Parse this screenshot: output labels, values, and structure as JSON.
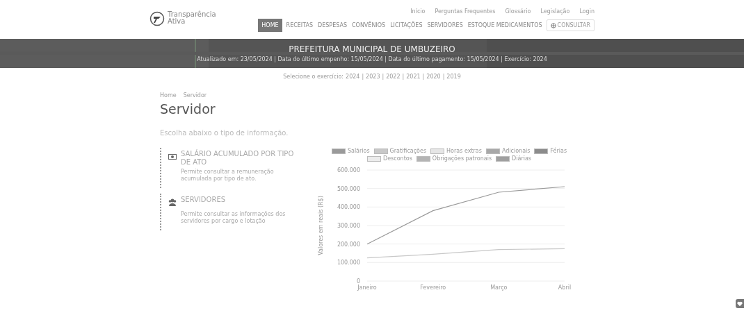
{
  "header": {
    "logo_text": [
      "Transparência",
      "Ativa"
    ],
    "top_links": [
      "Início",
      "Perguntas Frequentes",
      "Glossário",
      "Legislação",
      "Login"
    ],
    "nav": [
      {
        "label": "HOME",
        "selected": true
      },
      {
        "label": "RECEITAS",
        "selected": false
      },
      {
        "label": "DESPESAS",
        "selected": false
      },
      {
        "label": "CONVÊNIOS",
        "selected": false
      },
      {
        "label": "LICITAÇÕES",
        "selected": false
      },
      {
        "label": "SERVIDORES",
        "selected": false
      },
      {
        "label": "ESTOQUE MEDICAMENTOS",
        "selected": false
      }
    ],
    "nav_button": "CONSULTAR"
  },
  "banner": {
    "title": "PREFEITURA MUNICIPAL DE UMBUZEIRO",
    "info": "Atualizado em: 23/05/2024 | Data do último empenho: 15/05/2024 | Data do último pagamento: 15/05/2024 | Exercício: 2024"
  },
  "years": {
    "label": "Selecione o exercício:",
    "separator": "|",
    "items": [
      "2024",
      "2023",
      "2022",
      "2021",
      "2020",
      "2019"
    ]
  },
  "breadcrumb": [
    "Home",
    "Servidor"
  ],
  "title": "Servidor",
  "subtitle": "Escolha abaixo o tipo de informação.",
  "cards": [
    {
      "kind": "money",
      "title": "SALÁRIO ACUMULADO POR TIPO DE ATO",
      "text": "Permite consultar a remuneração acumulada por tipo de ato."
    },
    {
      "kind": "people",
      "title": "SERVIDORES",
      "text": "Permite consultar as informações dos servidores por cargo e lotação"
    }
  ],
  "chart_data": {
    "type": "line",
    "grid": true,
    "legend": true,
    "ylabel": "Valores em reais (R$)",
    "categories": [
      "Janeiro",
      "Fevereiro",
      "Março",
      "Abril"
    ],
    "yticks": [
      {
        "value": 0,
        "label": "0"
      },
      {
        "value": 100000,
        "label": "100.000"
      },
      {
        "value": 200000,
        "label": "200.000"
      },
      {
        "value": 300000,
        "label": "300.000"
      },
      {
        "value": 400000,
        "label": "400.000"
      },
      {
        "value": 500000,
        "label": "500.000"
      },
      {
        "value": 600000,
        "label": "600.000"
      }
    ],
    "ylim": [
      0,
      600000
    ],
    "series": [
      {
        "name": "Salários",
        "color": "#9a9a9a",
        "values": [
          200000,
          380000,
          480000,
          510000
        ]
      },
      {
        "name": "Gratificações",
        "color": "#c8c8c8",
        "values": [
          125000,
          145000,
          170000,
          175000
        ]
      },
      {
        "name": "Horas extras",
        "color": "#e6e6e6",
        "values": [
          null,
          null,
          null,
          null
        ]
      },
      {
        "name": "Adicionais",
        "color": "#a8a8a8",
        "values": [
          null,
          null,
          null,
          null
        ]
      },
      {
        "name": "Férias",
        "color": "#8c8c8c",
        "values": [
          null,
          null,
          null,
          null
        ]
      },
      {
        "name": "Descontos",
        "color": "#ececec",
        "values": [
          null,
          null,
          null,
          null
        ]
      },
      {
        "name": "Obrigações patronais",
        "color": "#b4b4b4",
        "values": [
          null,
          null,
          null,
          null
        ]
      },
      {
        "name": "Diárias",
        "color": "#a0a0a0",
        "values": [
          null,
          null,
          null,
          null
        ]
      }
    ]
  }
}
